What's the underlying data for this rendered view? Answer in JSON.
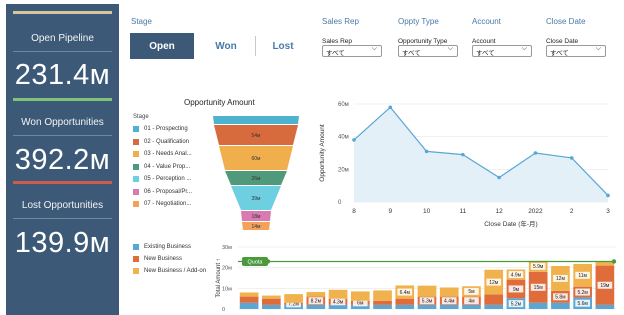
{
  "kpis": [
    {
      "label": "Open Pipeline",
      "value": "231.4м",
      "bar_color": "#d9c59a"
    },
    {
      "label": "Won Opportunities",
      "value": "392.2м",
      "bar_color": "#7fc379"
    },
    {
      "label": "Lost Opportunities",
      "value": "139.9м",
      "bar_color": "#cf5a4e"
    }
  ],
  "filters": {
    "stage_label": "Stage",
    "stage_options": [
      "Open",
      "Won",
      "Lost"
    ],
    "stage_selected": "Open",
    "headers": [
      "Sales Rep",
      "Oppty Type",
      "Account",
      "Close Date"
    ],
    "selects": [
      {
        "label": "Sales Rep",
        "value": "すべて"
      },
      {
        "label": "Opportunity Type",
        "value": "すべて"
      },
      {
        "label": "Account",
        "value": "すべて"
      },
      {
        "label": "Close Date",
        "value": "すべて"
      }
    ]
  },
  "funnel": {
    "title": "Opportunity Amount",
    "legend_title": "Stage",
    "legend": [
      {
        "label": "01 - Prospecting",
        "color": "#4eb3cf"
      },
      {
        "label": "02 - Qualification",
        "color": "#d86b3e"
      },
      {
        "label": "03 - Needs Anal...",
        "color": "#f0ae4d"
      },
      {
        "label": "04 - Value Prop...",
        "color": "#4f9a7a"
      },
      {
        "label": "05 - Perception ...",
        "color": "#6ecfe0"
      },
      {
        "label": "06 - Proposal/Pr...",
        "color": "#d97bb0"
      },
      {
        "label": "07 - Negotiation...",
        "color": "#f2a25a"
      }
    ],
    "segment_labels": [
      "",
      "54м",
      "60м",
      "26м",
      "39м",
      "18м",
      "14м"
    ]
  },
  "chart_data": [
    {
      "type": "line",
      "title": "",
      "xlabel": "Close Date (年-月)",
      "ylabel": "Opportunity Amount",
      "categories": [
        "8",
        "9",
        "10",
        "11",
        "12",
        "2022",
        "2",
        "3"
      ],
      "y_ticks": [
        "0",
        "20м",
        "40м",
        "60м"
      ],
      "ylim": [
        0,
        60
      ],
      "series": [
        {
          "name": "",
          "values": [
            38,
            58,
            31,
            29,
            15,
            30,
            27,
            4
          ]
        }
      ],
      "color": "#5aa7d6"
    },
    {
      "type": "bar",
      "ylabel": "Total Amount ↑",
      "y_ticks": [
        "0",
        "10м",
        "20м",
        "30м"
      ],
      "ylim": [
        0,
        30
      ],
      "quota_label": "Quota",
      "quota_value": 23,
      "legend": [
        {
          "label": "Existing Business",
          "color": "#5aa7d6"
        },
        {
          "label": "New Business",
          "color": "#e06c3c"
        },
        {
          "label": "New Business / Add-on",
          "color": "#f0b24d"
        }
      ],
      "stacks": [
        [
          3,
          3,
          2
        ],
        [
          2,
          3,
          1.5
        ],
        [
          2,
          1,
          4.2
        ],
        [
          2,
          4,
          2.2
        ],
        [
          2,
          3,
          4.3
        ],
        [
          2,
          2,
          4.5
        ],
        [
          2,
          2,
          5
        ],
        [
          2,
          3,
          6.4
        ],
        [
          2,
          4,
          5.3
        ],
        [
          2,
          4,
          4.4
        ],
        [
          2,
          4,
          5
        ],
        [
          2,
          5,
          12
        ],
        [
          5.2,
          9,
          4.9
        ],
        [
          3,
          15,
          5.3
        ],
        [
          3,
          5.8,
          12
        ],
        [
          5.6,
          5.2,
          11
        ],
        [
          2,
          19,
          2
        ]
      ],
      "bar_labels": [
        [
          "",
          "",
          ""
        ],
        [
          "",
          "",
          ""
        ],
        [
          "",
          "7.2м",
          ""
        ],
        [
          "",
          "8.2м",
          ""
        ],
        [
          "",
          "4.3м",
          ""
        ],
        [
          "",
          "6м",
          ""
        ],
        [
          "",
          "",
          ""
        ],
        [
          "",
          "",
          "6.4м"
        ],
        [
          "",
          "5.3м",
          ""
        ],
        [
          "",
          "4.4м",
          ""
        ],
        [
          "",
          "4м",
          "5м"
        ],
        [
          "",
          "",
          "12м"
        ],
        [
          "5.2м",
          "9м",
          "4.9м"
        ],
        [
          "",
          "15м",
          "5.9м"
        ],
        [
          "",
          "5.8м",
          "12м"
        ],
        [
          "5.6м",
          "5.2м",
          "11м"
        ],
        [
          "",
          "19м",
          ""
        ]
      ]
    }
  ]
}
